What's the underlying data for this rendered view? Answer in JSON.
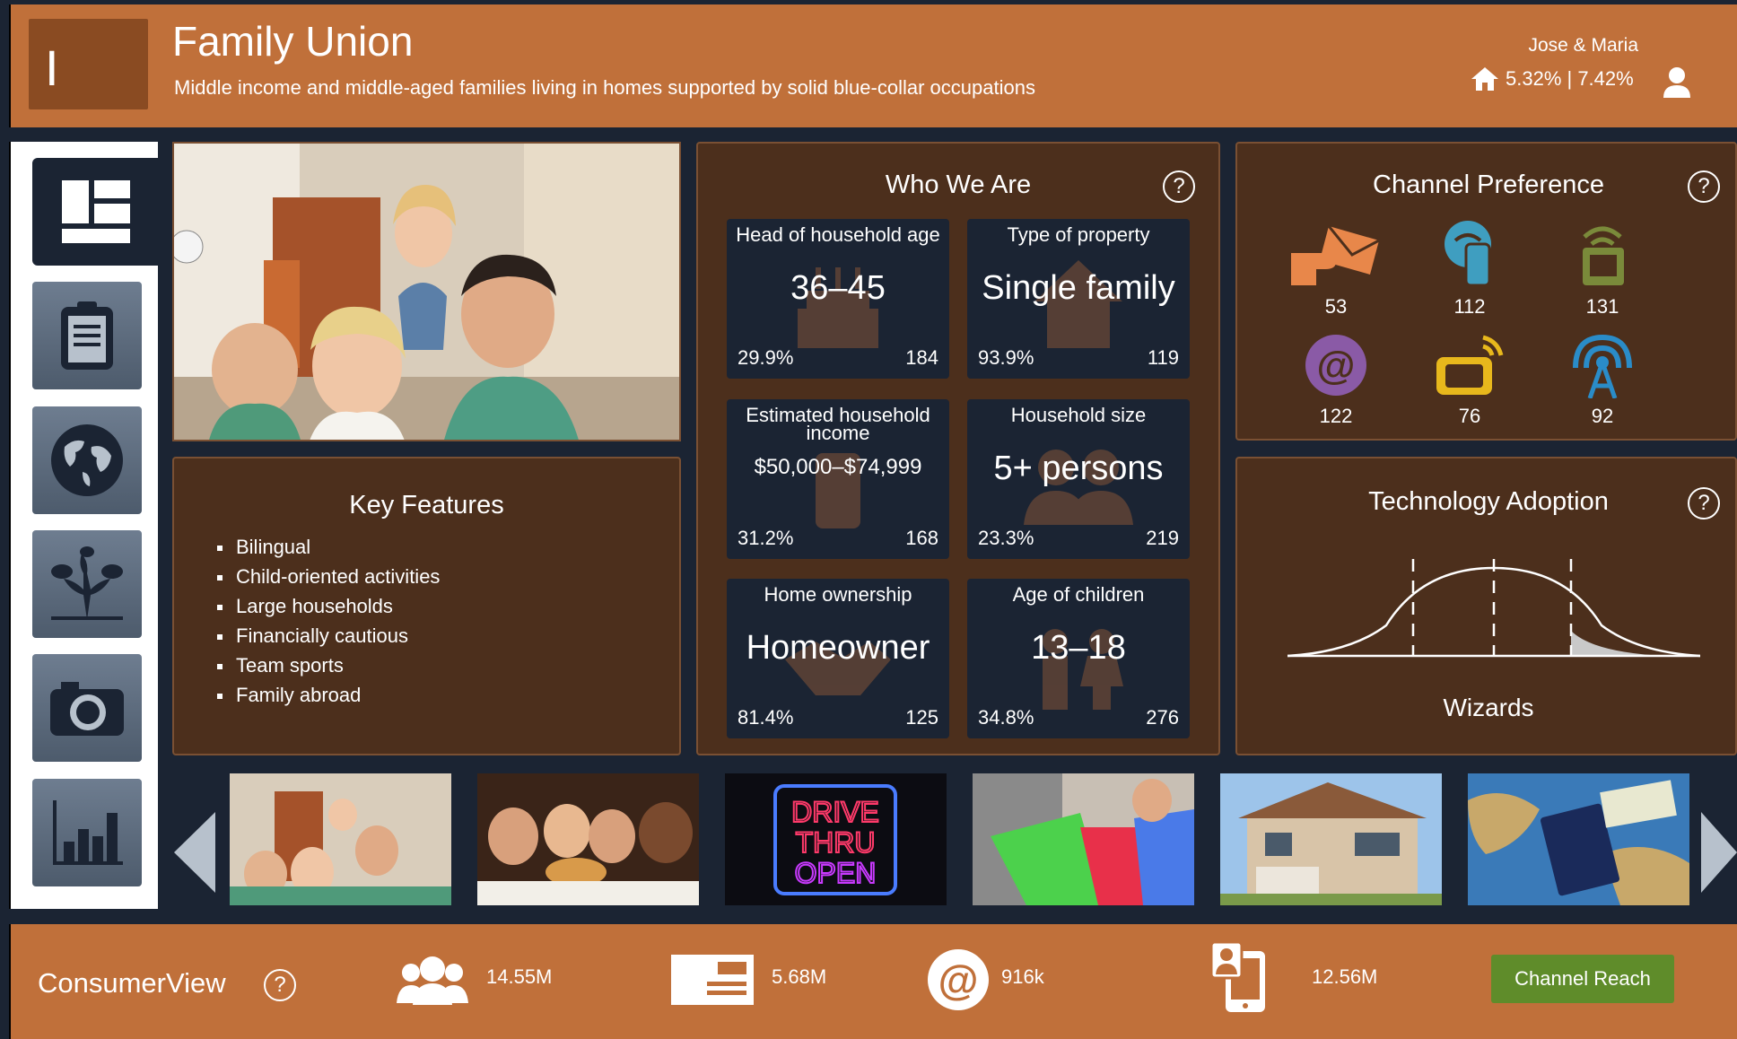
{
  "header": {
    "logo_letter": "I",
    "title": "Family Union",
    "subtitle": "Middle income and middle-aged families living in homes supported by solid blue-collar occupations",
    "user": "Jose & Maria",
    "stats": "5.32% | 7.42%"
  },
  "sidebar": {
    "items": [
      {
        "name": "dashboard-icon",
        "active": true
      },
      {
        "name": "clipboard-icon"
      },
      {
        "name": "globe-icon"
      },
      {
        "name": "tree-icon"
      },
      {
        "name": "camera-icon"
      },
      {
        "name": "bar-chart-icon"
      }
    ]
  },
  "key_features": {
    "title": "Key Features",
    "items": [
      "Bilingual",
      "Child-oriented activities",
      "Large households",
      "Financially cautious",
      "Team sports",
      "Family abroad"
    ]
  },
  "who_we_are": {
    "title": "Who We Are",
    "tiles": [
      {
        "label": "Head of household age",
        "value": "36–45",
        "pct": "29.9%",
        "index": "184"
      },
      {
        "label": "Type of property",
        "value": "Single family",
        "pct": "93.9%",
        "index": "119"
      },
      {
        "label": "Estimated household income",
        "value": "$50,000–$74,999",
        "pct": "31.2%",
        "index": "168"
      },
      {
        "label": "Household size",
        "value": "5+ persons",
        "pct": "23.3%",
        "index": "219"
      },
      {
        "label": "Home ownership",
        "value": "Homeowner",
        "pct": "81.4%",
        "index": "125"
      },
      {
        "label": "Age of children",
        "value": "13–18",
        "pct": "34.8%",
        "index": "276"
      }
    ]
  },
  "channel_preference": {
    "title": "Channel Preference",
    "items": [
      {
        "icon": "direct-mail-icon",
        "value": "53",
        "color": "#e8874a"
      },
      {
        "icon": "mobile-wifi-icon",
        "value": "112",
        "color": "#3f9ec0"
      },
      {
        "icon": "tablet-wifi-icon",
        "value": "131",
        "color": "#7a8a3a"
      },
      {
        "icon": "email-at-icon",
        "value": "122",
        "color": "#8a5aa6"
      },
      {
        "icon": "tv-icon",
        "value": "76",
        "color": "#e8b81c"
      },
      {
        "icon": "broadcast-tower-icon",
        "value": "92",
        "color": "#2a8cc8"
      }
    ]
  },
  "technology_adoption": {
    "title": "Technology Adoption",
    "label": "Wizards"
  },
  "thumbnails": [
    "family-photo",
    "diner-photo",
    "drive-thru-sign-photo",
    "shopping-bags-photo",
    "house-photo",
    "passport-map-photo"
  ],
  "footer": {
    "brand": "ConsumerView",
    "stats": [
      {
        "icon": "people-icon",
        "value": "14.55M"
      },
      {
        "icon": "mail-card-icon",
        "value": "5.68M"
      },
      {
        "icon": "at-icon",
        "value": "916k"
      },
      {
        "icon": "mobile-person-icon",
        "value": "12.56M"
      }
    ],
    "button": "Channel Reach"
  },
  "colors": {
    "header_bg": "#c0703a",
    "panel_bg": "#4c2f1c",
    "tile_bg": "#1b2433",
    "button_bg": "#5f8c2a"
  }
}
